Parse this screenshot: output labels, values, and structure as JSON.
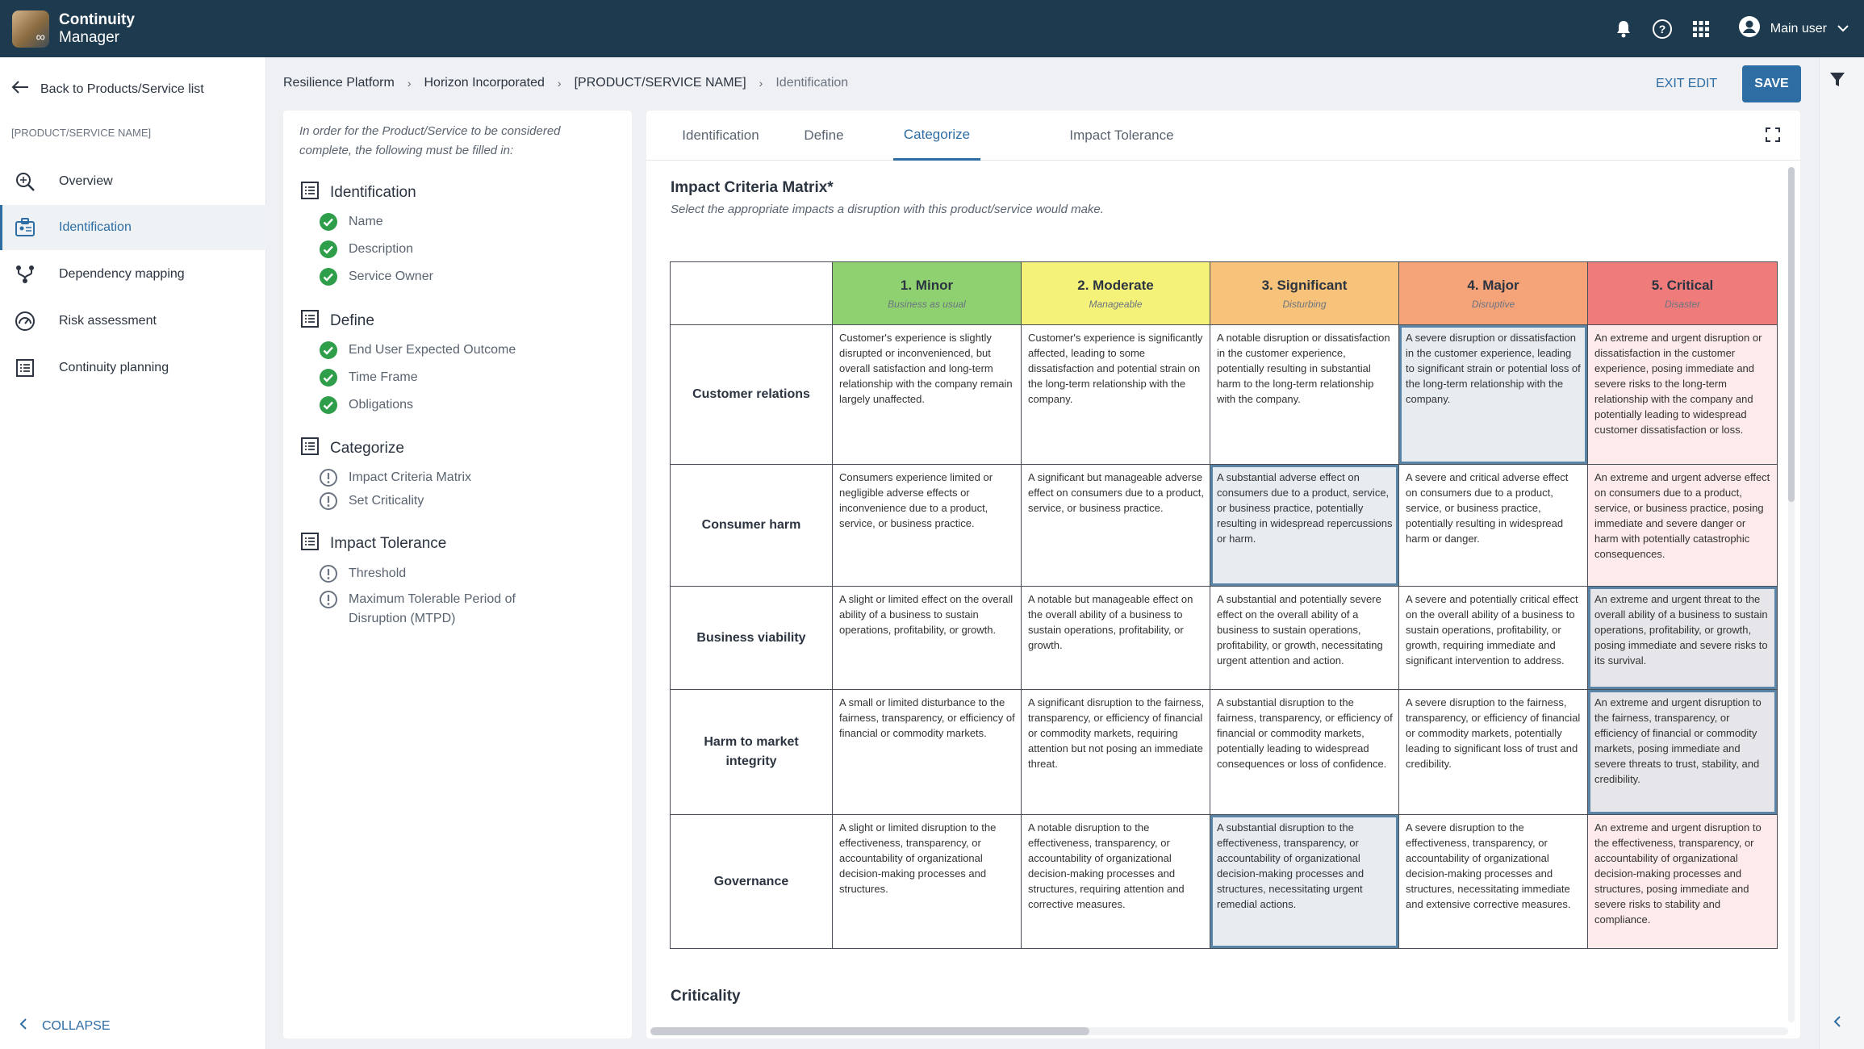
{
  "app": {
    "title_line1": "Continuity",
    "title_line2": "Manager",
    "user_name": "Main user"
  },
  "sidebar": {
    "back_label": "Back to Products/Service list",
    "product_name": "[PRODUCT/SERVICE NAME]",
    "items": [
      {
        "label": "Overview",
        "icon": "search-icon"
      },
      {
        "label": "Identification",
        "icon": "id-card-icon",
        "active": true
      },
      {
        "label": "Dependency mapping",
        "icon": "fork-icon"
      },
      {
        "label": "Risk assessment",
        "icon": "gauge-icon"
      },
      {
        "label": "Continuity planning",
        "icon": "list-icon"
      }
    ],
    "collapse_label": "COLLAPSE"
  },
  "breadcrumb": [
    "Resilience Platform",
    "Horizon Incorporated",
    "[PRODUCT/SERVICE NAME]",
    "Identification"
  ],
  "toolbar": {
    "exit_edit_label": "EXIT EDIT",
    "save_label": "SAVE"
  },
  "checklist": {
    "intro": "In order for the Product/Service to be considered complete, the following must be filled in:",
    "sections": [
      {
        "title": "Identification",
        "items": [
          {
            "label": "Name",
            "status": "done"
          },
          {
            "label": "Description",
            "status": "done"
          },
          {
            "label": "Service Owner",
            "status": "done"
          }
        ]
      },
      {
        "title": "Define",
        "items": [
          {
            "label": "End User Expected Outcome",
            "status": "done"
          },
          {
            "label": "Time Frame",
            "status": "done"
          },
          {
            "label": "Obligations",
            "status": "done"
          }
        ]
      },
      {
        "title": "Categorize",
        "items": [
          {
            "label": "Impact Criteria Matrix",
            "status": "pending"
          },
          {
            "label": "Set Criticality",
            "status": "pending"
          }
        ]
      },
      {
        "title": "Impact Tolerance",
        "items": [
          {
            "label": "Threshold",
            "status": "pending"
          },
          {
            "label": "Maximum Tolerable Period of Disruption (MTPD)",
            "status": "pending"
          }
        ]
      }
    ]
  },
  "tabs": [
    {
      "label": "Identification"
    },
    {
      "label": "Define"
    },
    {
      "label": "Categorize",
      "active": true
    },
    {
      "label": "Impact Tolerance"
    }
  ],
  "matrix": {
    "title": "Impact Criteria Matrix*",
    "subtitle": "Select the appropriate impacts a disruption with this product/service would make.",
    "levels": [
      {
        "name": "1. Minor",
        "sub": "Business as usual",
        "color": "#8fd170"
      },
      {
        "name": "2. Moderate",
        "sub": "Manageable",
        "color": "#f5f27a"
      },
      {
        "name": "3. Significant",
        "sub": "Disturbing",
        "color": "#f7c279"
      },
      {
        "name": "4. Major",
        "sub": "Disruptive",
        "color": "#f5a378"
      },
      {
        "name": "5. Critical",
        "sub": "Disaster",
        "color": "#ef7b7b"
      }
    ],
    "rows": [
      {
        "label": "Customer relations",
        "selected": 3,
        "cells": [
          "Customer's experience is slightly disrupted or inconvenienced, but overall satisfaction and long-term relationship with the company remain largely unaffected.",
          "Customer's experience is significantly affected, leading to some dissatisfaction and potential strain on the long-term relationship with the company.",
          "A notable disruption or dissatisfaction in the customer experience, potentially resulting in substantial harm to the long-term relationship with the company.",
          "A severe disruption or dissatisfaction in the customer experience, leading to significant strain or potential loss of the long-term relationship with the company.",
          "An extreme and urgent disruption or dissatisfaction in the customer experience, posing immediate and severe risks to the long-term relationship with the company and potentially leading to widespread customer dissatisfaction or loss."
        ]
      },
      {
        "label": "Consumer harm",
        "selected": 2,
        "cells": [
          "Consumers experience limited or negligible adverse effects or inconvenience due to a product, service, or business practice.",
          "A significant but manageable adverse effect on consumers due to a product, service, or business practice.",
          "A substantial adverse effect on consumers due to a product, service, or business practice, potentially resulting in widespread repercussions or harm.",
          "A severe and critical adverse effect on consumers due to a product, service, or business practice, potentially resulting in widespread harm or danger.",
          "An extreme and urgent adverse effect on consumers due to a product, service, or business practice, posing immediate and severe danger or harm with potentially catastrophic consequences."
        ]
      },
      {
        "label": "Business viability",
        "selected": 4,
        "cells": [
          "A slight or limited effect on the overall ability of a business to sustain operations, profitability, or growth.",
          "A notable but manageable effect on the overall ability of a business to sustain operations, profitability, or growth.",
          "A substantial and potentially severe effect on the overall ability of a business to sustain operations, profitability, or growth, necessitating urgent attention and action.",
          "A severe and potentially critical effect on the overall ability of a business to sustain operations, profitability, or growth, requiring immediate and significant intervention to address.",
          "An extreme and urgent threat to the overall ability of a business to sustain operations, profitability, or growth, posing immediate and severe risks to its survival."
        ]
      },
      {
        "label": "Harm to market integrity",
        "selected": 4,
        "cells": [
          "A small or limited disturbance to the fairness, transparency, or efficiency of financial or commodity markets.",
          "A significant disruption to the fairness, transparency, or efficiency of financial or commodity markets, requiring attention but not posing an immediate threat.",
          "A substantial disruption to the fairness, transparency, or efficiency of financial or commodity markets, potentially leading to widespread consequences or loss of confidence.",
          "A severe disruption to the fairness, transparency, or efficiency of financial or commodity markets, potentially leading to significant loss of trust and credibility.",
          "An extreme and urgent disruption to the fairness, transparency, or efficiency of financial or commodity markets, posing immediate and severe threats to trust, stability, and credibility."
        ]
      },
      {
        "label": "Governance",
        "selected": 2,
        "cells": [
          "A slight or limited disruption to the effectiveness, transparency, or accountability of organizational decision-making processes and structures.",
          "A notable disruption to the effectiveness, transparency, or accountability of organizational decision-making processes and structures, requiring attention and corrective measures.",
          "A substantial disruption to the effectiveness, transparency, or accountability of organizational decision-making processes and structures, necessitating urgent remedial actions.",
          "A severe disruption to the effectiveness, transparency, or accountability of organizational decision-making processes and structures, necessitating immediate and extensive corrective measures.",
          "An extreme and urgent disruption to the effectiveness, transparency, or accountability of organizational decision-making processes and structures, posing immediate and severe risks to stability and compliance."
        ]
      }
    ]
  },
  "criticality_title": "Criticality"
}
